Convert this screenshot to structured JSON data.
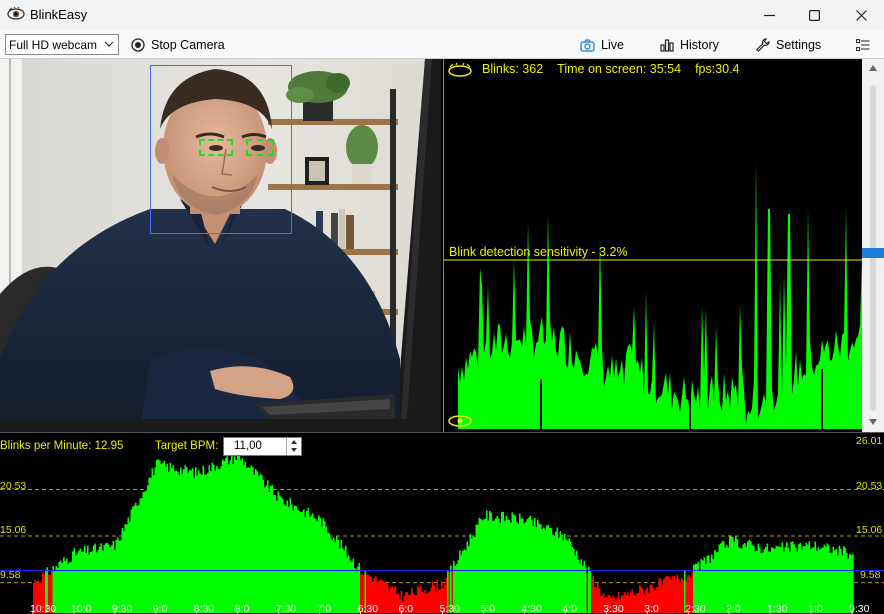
{
  "window": {
    "title": "BlinkEasy",
    "minimize_icon": "minimize-icon",
    "maximize_icon": "maximize-icon",
    "close_icon": "close-icon"
  },
  "toolbar": {
    "camera_select_value": "Full HD webcam",
    "stop_camera_label": "Stop Camera",
    "live_label": "Live",
    "history_label": "History",
    "settings_label": "Settings"
  },
  "signal": {
    "blinks": "Blinks: 362",
    "time_on_screen": "Time on screen: 35:54",
    "fps": "fps:30.4",
    "sensitivity_label": "Blink detection sensitivity - 3.2%",
    "sensitivity_percent": 3.2,
    "background_color": "#000000",
    "signal_color": "#00ff00",
    "threshold_color": "#f0f000"
  },
  "slider": {
    "level_fraction": 0.56,
    "thumb_color": "#1a7fd6"
  },
  "bpm_panel": {
    "bpm_label": "Blinks per Minute: 12.95",
    "target_label": "Target BPM:",
    "target_value": "11,00",
    "y_ticks": [
      "26.01",
      "20.53",
      "15.06",
      "9.58"
    ],
    "x_ticks": [
      "10:30",
      "10:0",
      "9:30",
      "9:0",
      "8:30",
      "8:0",
      "7:30",
      "7:0",
      "6:30",
      "6:0",
      "5:30",
      "5:0",
      "4:30",
      "4:0",
      "3:30",
      "3:0",
      "2:30",
      "2:0",
      "1:30",
      "1:0",
      "0:30"
    ],
    "above_color": "#00ff00",
    "below_color": "#ff0000",
    "target_line_color": "#1a1aff"
  },
  "chart_data": [
    {
      "type": "area",
      "title": "",
      "xlabel": "",
      "ylabel": "",
      "x": [
        "10:30",
        "10:0",
        "9:30",
        "9:0",
        "8:30",
        "8:0",
        "7:30",
        "7:0",
        "6:30",
        "6:0",
        "5:30",
        "5:0",
        "4:30",
        "4:0",
        "3:30",
        "3:0",
        "2:30",
        "2:0",
        "1:30",
        "1:0",
        "0:30"
      ],
      "series": [
        {
          "values": [
            9.6,
            13.0,
            14.0,
            23.5,
            22.5,
            24.5,
            19.5,
            17.0,
            11.0,
            8.0,
            9.5,
            17.5,
            17.0,
            15.0,
            7.5,
            9.0,
            10.5,
            14.5,
            13.5,
            14.0,
            13.0
          ]
        }
      ],
      "ylim": [
        6.0,
        26.01
      ],
      "reference_lines": [
        9.58,
        15.06,
        20.53
      ],
      "target": 11.0
    }
  ]
}
